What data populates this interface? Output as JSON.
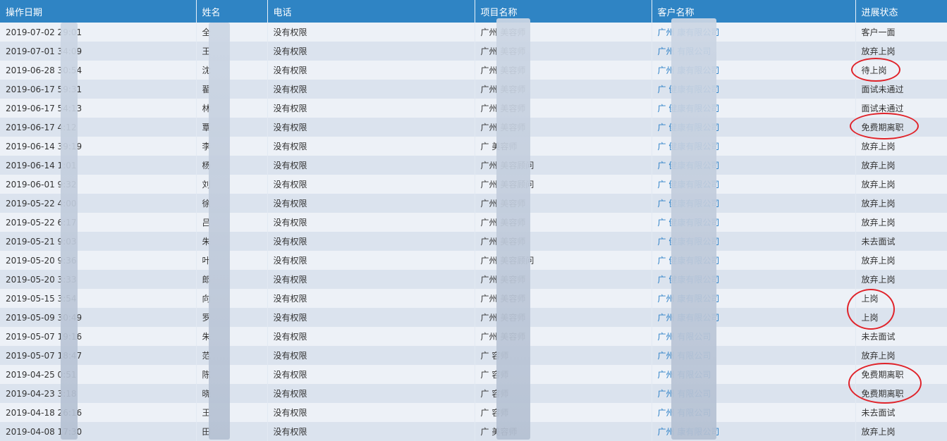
{
  "headers": [
    "操作日期",
    "姓名",
    "电话",
    "项目名称",
    "客户名称",
    "进展状态"
  ],
  "rows": [
    {
      "date": "2019-07-02 29:01",
      "name": "全",
      "phone": "没有权限",
      "project": "广州 美容师",
      "client": "广州 康有限公司",
      "status": "客户一面"
    },
    {
      "date": "2019-07-01 34:09",
      "name": "王",
      "phone": "没有权限",
      "project": "广州 美容师",
      "client": "广州 有限公司",
      "status": "放弃上岗"
    },
    {
      "date": "2019-06-28 30:54",
      "name": "沈",
      "phone": "没有权限",
      "project": "广州 美容师",
      "client": "广州 康有限公司",
      "status": "待上岗"
    },
    {
      "date": "2019-06-17 59:31",
      "name": "翟",
      "phone": "没有权限",
      "project": "广州 美容师",
      "client": "广 健康有限公司",
      "status": "面试未通过"
    },
    {
      "date": "2019-06-17 54:13",
      "name": "林",
      "phone": "没有权限",
      "project": "广州 美容师",
      "client": "广 健康有限公司",
      "status": "面试未通过"
    },
    {
      "date": "2019-06-17 4:12",
      "name": "覃",
      "phone": "没有权限",
      "project": "广州 美容师",
      "client": "广 健康有限公司",
      "status": "免费期离职"
    },
    {
      "date": "2019-06-14 39:19",
      "name": "李",
      "phone": "没有权限",
      "project": "广 美容师",
      "client": "广 健康有限公司",
      "status": "放弃上岗"
    },
    {
      "date": "2019-06-14 1:01",
      "name": "杨",
      "phone": "没有权限",
      "project": "广州 美容顾问",
      "client": "广 健康有限公司",
      "status": "放弃上岗"
    },
    {
      "date": "2019-06-01 9:32",
      "name": "刘",
      "phone": "没有权限",
      "project": "广州 美容顾问",
      "client": "广 健康有限公司",
      "status": "放弃上岗"
    },
    {
      "date": "2019-05-22 4:00",
      "name": "徐",
      "phone": "没有权限",
      "project": "广州 美容师",
      "client": "广 健康有限公司",
      "status": "放弃上岗"
    },
    {
      "date": "2019-05-22 6:17",
      "name": "吕",
      "phone": "没有权限",
      "project": "广州 美容师",
      "client": "广 健康有限公司",
      "status": "放弃上岗"
    },
    {
      "date": "2019-05-21 9:03",
      "name": "朱",
      "phone": "没有权限",
      "project": "广州 美容师",
      "client": "广 健康有限公司",
      "status": "未去面试"
    },
    {
      "date": "2019-05-20 9:36",
      "name": "叶",
      "phone": "没有权限",
      "project": "广州 美容顾问",
      "client": "广 健康有限公司",
      "status": "放弃上岗"
    },
    {
      "date": "2019-05-20 3:33",
      "name": "郎",
      "phone": "没有权限",
      "project": "广州 美容师",
      "client": "广 健康有限公司",
      "status": "放弃上岗"
    },
    {
      "date": "2019-05-15 3:54",
      "name": "向",
      "phone": "没有权限",
      "project": "广州 美容师",
      "client": "广州 康有限公司",
      "status": "上岗"
    },
    {
      "date": "2019-05-09 30:49",
      "name": "罗",
      "phone": "没有权限",
      "project": "广州 美容师",
      "client": "广州 康有限公司",
      "status": "上岗"
    },
    {
      "date": "2019-05-07 19:16",
      "name": "朱",
      "phone": "没有权限",
      "project": "广州 美容师",
      "client": "广州 有限公司",
      "status": "未去面试"
    },
    {
      "date": "2019-05-07 18:47",
      "name": "范",
      "phone": "没有权限",
      "project": "广 容师",
      "client": "广州 有限公司",
      "status": "放弃上岗"
    },
    {
      "date": "2019-04-25 0:51",
      "name": "陈",
      "phone": "没有权限",
      "project": "广 容师",
      "client": "广州 有限公司",
      "status": "免费期离职"
    },
    {
      "date": "2019-04-23 3:18",
      "name": "晓",
      "phone": "没有权限",
      "project": "广 容师",
      "client": "广州 有限公司",
      "status": "免费期离职"
    },
    {
      "date": "2019-04-18 26:16",
      "name": "王",
      "phone": "没有权限",
      "project": "广 容师",
      "client": "广州 有限公司",
      "status": "未去面试"
    },
    {
      "date": "2019-04-08 17:30",
      "name": "田",
      "phone": "没有权限",
      "project": "广 美容师",
      "client": "广州 康有限公司",
      "status": "放弃上岗"
    }
  ]
}
